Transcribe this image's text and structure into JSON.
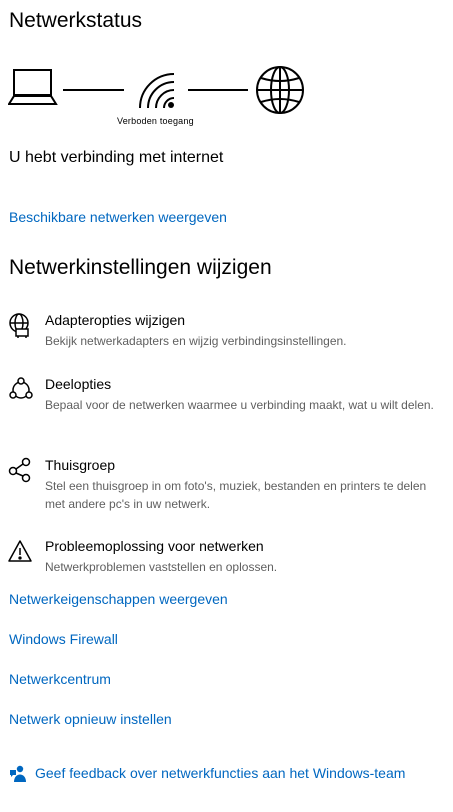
{
  "status": {
    "heading": "Netwerkstatus",
    "diagram": {
      "devices": [
        "laptop-icon",
        "wifi-icon",
        "globe-icon"
      ],
      "caption": "Verboden toegang"
    },
    "connection_text": "U hebt verbinding met internet",
    "show_networks_link": "Beschikbare netwerken weergeven"
  },
  "settings": {
    "heading": "Netwerkinstellingen wijzigen",
    "options": [
      {
        "icon": "adapter-icon",
        "title": "Adapteropties wijzigen",
        "description": "Bekijk netwerkadapters en wijzig verbindingsinstellingen."
      },
      {
        "icon": "sharing-icon",
        "title": "Deelopties",
        "description": "Bepaal voor de netwerken waarmee u verbinding maakt, wat u wilt delen."
      },
      {
        "icon": "homegroup-icon",
        "title": "Thuisgroep",
        "description": "Stel een thuisgroep in om foto's, muziek, bestanden en printers te delen met andere pc's in uw netwerk."
      },
      {
        "icon": "warning-icon",
        "title": "Probleemoplossing voor netwerken",
        "description": "Netwerkproblemen vaststellen en oplossen."
      }
    ]
  },
  "links": [
    "Netwerkeigenschappen weergeven",
    "Windows Firewall",
    "Netwerkcentrum",
    "Netwerk opnieuw instellen"
  ],
  "feedback": {
    "icon": "feedback-icon",
    "label": "Geef feedback over netwerkfuncties aan het Windows-team"
  },
  "colors": {
    "link": "#0067c0",
    "secondary_text": "#5f5f5f"
  }
}
